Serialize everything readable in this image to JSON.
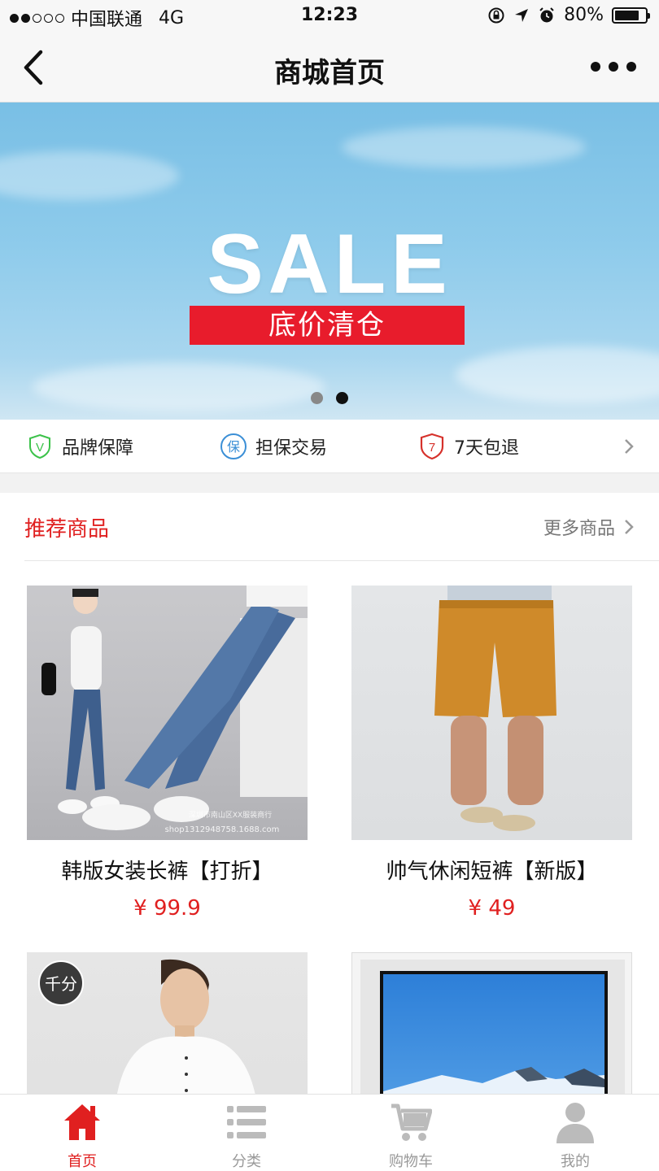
{
  "status_bar": {
    "carrier": "中国联通",
    "network": "4G",
    "time": "12:23",
    "battery": "80%",
    "battery_level": 0.8
  },
  "nav": {
    "title": "商城首页"
  },
  "banner": {
    "headline": "SALE",
    "tag": "底价清仓",
    "slide_count": 2,
    "active_slide": 2
  },
  "guarantees": [
    {
      "icon": "v-shield-icon",
      "label": "品牌保障"
    },
    {
      "icon": "bao-circle-icon",
      "label": "担保交易"
    },
    {
      "icon": "seven-shield-icon",
      "label": "7天包退"
    }
  ],
  "section": {
    "title": "推荐商品",
    "more_label": "更多商品"
  },
  "products": [
    {
      "name": "韩版女装长裤【打折】",
      "price": "¥ 99.9",
      "image": "jeans-model-photo",
      "watermark": "深圳市南山区XX服装商行 shop1312948758 .1688.com"
    },
    {
      "name": "帅气休闲短裤【新版】",
      "price": "¥ 49",
      "image": "orange-shorts-photo"
    },
    {
      "name": "",
      "price": "",
      "image": "white-shirt-model-photo",
      "badge": "千分"
    },
    {
      "name": "",
      "price": "",
      "image": "tv-snow-mountain-photo"
    }
  ],
  "tabs": [
    {
      "label": "首页",
      "icon": "home-icon",
      "active": true
    },
    {
      "label": "分类",
      "icon": "list-icon",
      "active": false
    },
    {
      "label": "购物车",
      "icon": "cart-icon",
      "active": false
    },
    {
      "label": "我的",
      "icon": "user-icon",
      "active": false
    }
  ],
  "colors": {
    "accent": "#e02020",
    "banner_tag": "#e81c2c",
    "inactive": "#999999"
  }
}
